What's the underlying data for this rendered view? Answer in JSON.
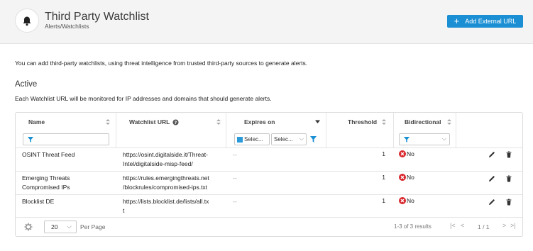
{
  "header": {
    "title": "Third Party Watchlist",
    "breadcrumb": "Alerts/Watchlists",
    "add_button": "Add External URL"
  },
  "intro": "You can add third-party watchlists, using threat intelligence from trusted third-party sources to generate alerts.",
  "section": {
    "title": "Active",
    "description": "Each Watchlist URL will be monitored for IP addresses and domains that should generate alerts."
  },
  "table": {
    "columns": {
      "name": "Name",
      "url": "Watchlist URL",
      "expires": "Expires on",
      "threshold": "Threshold",
      "bidirectional": "Bidirectional"
    },
    "filters": {
      "expires_a": "Selec...",
      "expires_b": "Selec..."
    },
    "rows": [
      {
        "name_1": "OSINT Threat Feed",
        "name_2": "",
        "url_1": "https://osint.digitalside.it/Threat-",
        "url_2": "Intel/digitalside-misp-feed/",
        "expires": "--",
        "threshold": "1",
        "bidirectional": "No"
      },
      {
        "name_1": "Emerging Threats",
        "name_2": "Compromised IPs",
        "url_1": "https://rules.emergingthreats.net",
        "url_2": "/blockrules/compromised-ips.txt",
        "expires": "--",
        "threshold": "1",
        "bidirectional": "No"
      },
      {
        "name_1": "Blocklist DE",
        "name_2": "",
        "url_1": "https://lists.blocklist.de/lists/all.tx",
        "url_2": "t",
        "expires": "--",
        "threshold": "1",
        "bidirectional": "No"
      }
    ],
    "footer": {
      "per_page_value": "20",
      "per_page_label": "Per Page",
      "range": "1-3 of 3 results",
      "pages": "1 / 1"
    }
  },
  "colors": {
    "accent": "#1a8fd4",
    "danger": "#d9262c"
  },
  "icons": [
    "bell-icon",
    "plus-icon",
    "sort-icon",
    "help-icon",
    "chevron-down-icon",
    "filter-icon",
    "x-circle-icon",
    "pencil-icon",
    "trash-icon",
    "gear-icon",
    "first-page-icon",
    "prev-page-icon",
    "next-page-icon",
    "last-page-icon"
  ]
}
